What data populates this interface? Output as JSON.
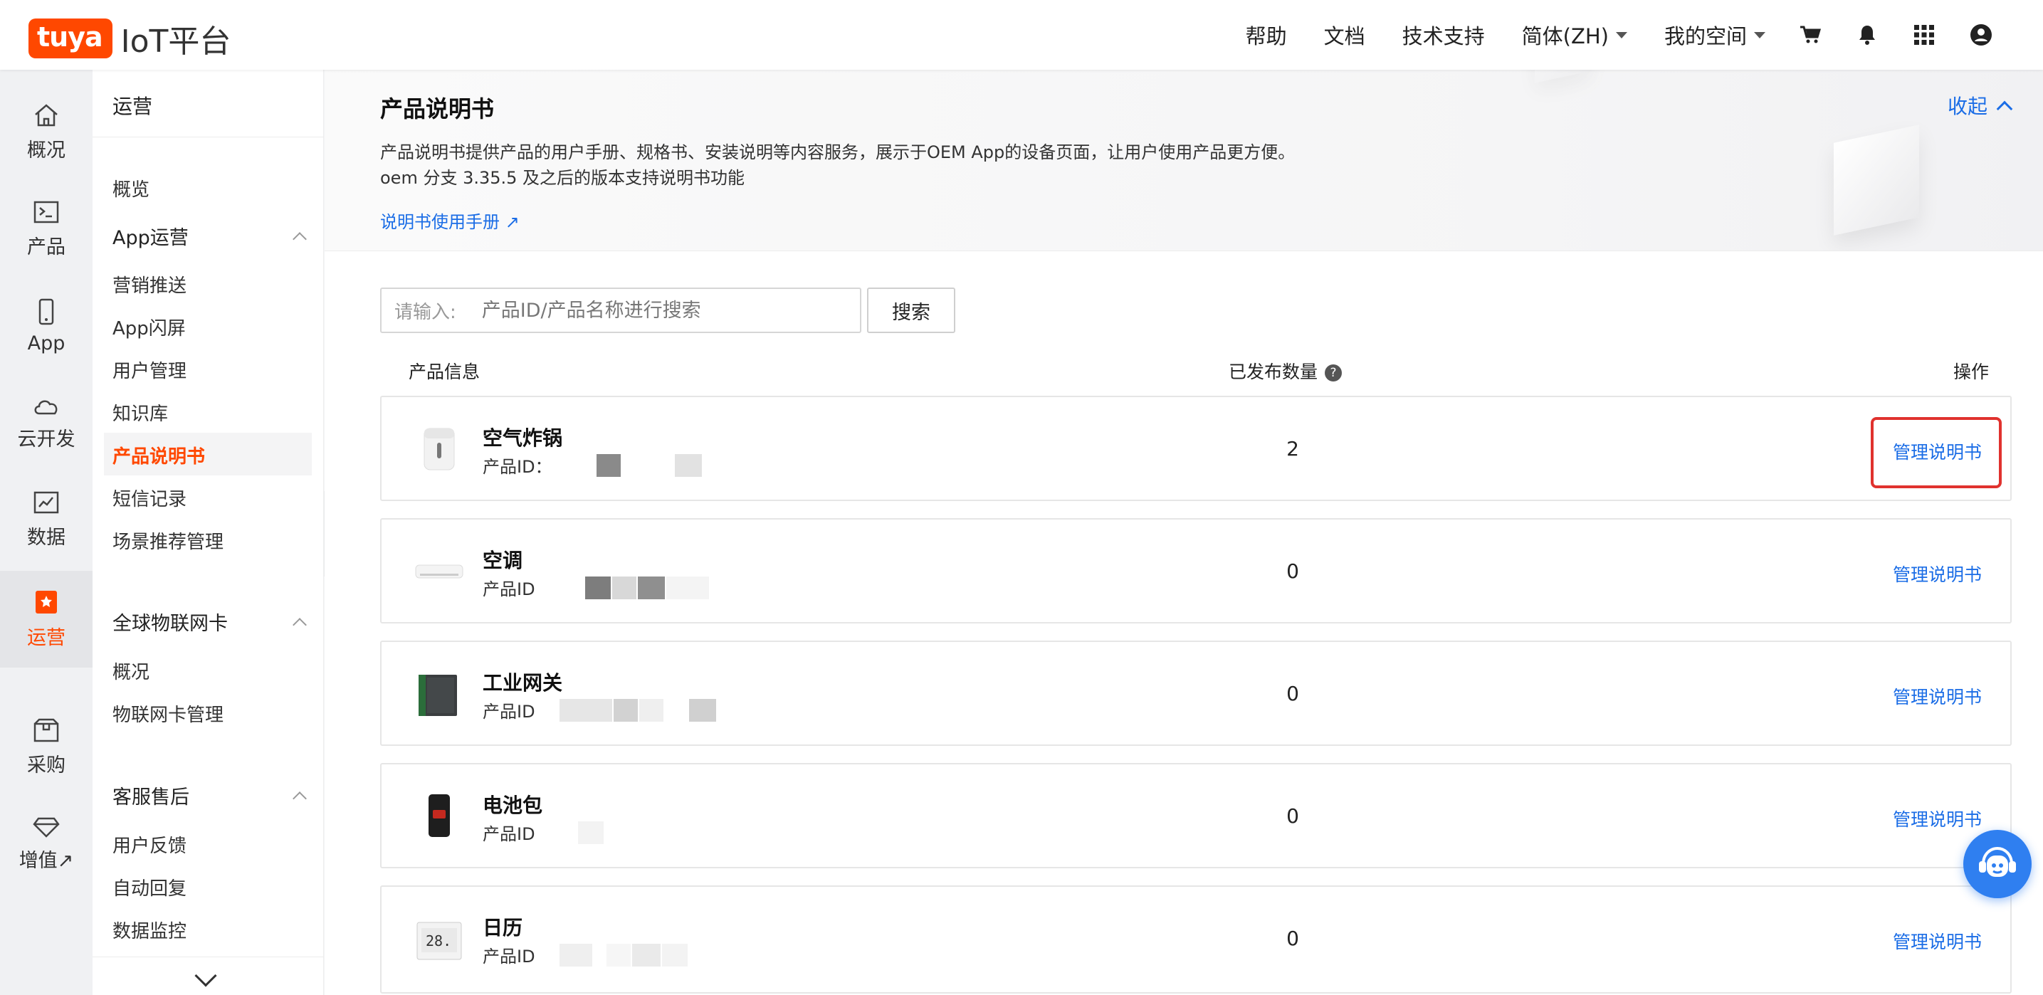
{
  "header": {
    "logo_badge": "tuya",
    "logo_text": "IoT平台",
    "nav": [
      "帮助",
      "文档",
      "技术支持"
    ],
    "language": "简体(ZH)",
    "space": "我的空间",
    "icons": [
      "cart-icon",
      "bell-icon",
      "apps-grid-icon",
      "user-icon"
    ]
  },
  "iconbar": {
    "items": [
      {
        "label": "概况",
        "icon": "home-icon"
      },
      {
        "label": "产品",
        "icon": "terminal-icon"
      },
      {
        "label": "App",
        "icon": "phone-icon"
      },
      {
        "label": "云开发",
        "icon": "cloud-icon"
      },
      {
        "label": "数据",
        "icon": "chart-icon"
      },
      {
        "label": "运营",
        "icon": "bookmark-icon"
      },
      {
        "label": "采购",
        "icon": "box-icon"
      },
      {
        "label": "增值↗",
        "icon": "diamond-icon"
      }
    ]
  },
  "submenu": {
    "title": "运营",
    "overview": "概览",
    "groups": [
      {
        "label": "App运营",
        "items": [
          "营销推送",
          "App闪屏",
          "用户管理",
          "知识库",
          "产品说明书",
          "短信记录",
          "场景推荐管理"
        ]
      },
      {
        "label": "全球物联网卡",
        "items": [
          "概况",
          "物联网卡管理"
        ]
      },
      {
        "label": "客服售后",
        "items": [
          "用户反馈",
          "自动回复",
          "数据监控"
        ]
      }
    ]
  },
  "banner": {
    "title": "产品说明书",
    "desc1": "产品说明书提供产品的用户手册、规格书、安装说明等内容服务，展示于OEM App的设备页面，让用户使用产品更方便。",
    "desc2": "oem 分支 3.35.5 及之后的版本支持说明书功能",
    "link": "说明书使用手册 ↗",
    "collapse": "收起"
  },
  "search": {
    "label": "请输入:",
    "placeholder": "产品ID/产品名称进行搜索",
    "button": "搜索"
  },
  "table": {
    "headers": {
      "info": "产品信息",
      "count": "已发布数量",
      "action": "操作"
    },
    "rows": [
      {
        "name": "空气炸锅",
        "id_label": "产品ID：",
        "count": "2",
        "action": "管理说明书",
        "thumb": "air-fryer"
      },
      {
        "name": "空调",
        "id_label": "产品ID",
        "count": "0",
        "action": "管理说明书",
        "thumb": "air-conditioner"
      },
      {
        "name": "工业网关",
        "id_label": "产品ID",
        "count": "0",
        "action": "管理说明书",
        "thumb": "gateway"
      },
      {
        "name": "电池包",
        "id_label": "产品ID",
        "count": "0",
        "action": "管理说明书",
        "thumb": "battery"
      },
      {
        "name": "日历",
        "id_label": "产品ID",
        "count": "0",
        "action": "管理说明书",
        "thumb": "calendar"
      }
    ]
  },
  "colors": {
    "brand": "#ff4800",
    "link": "#1b6de6",
    "highlight": "#e0322e"
  }
}
